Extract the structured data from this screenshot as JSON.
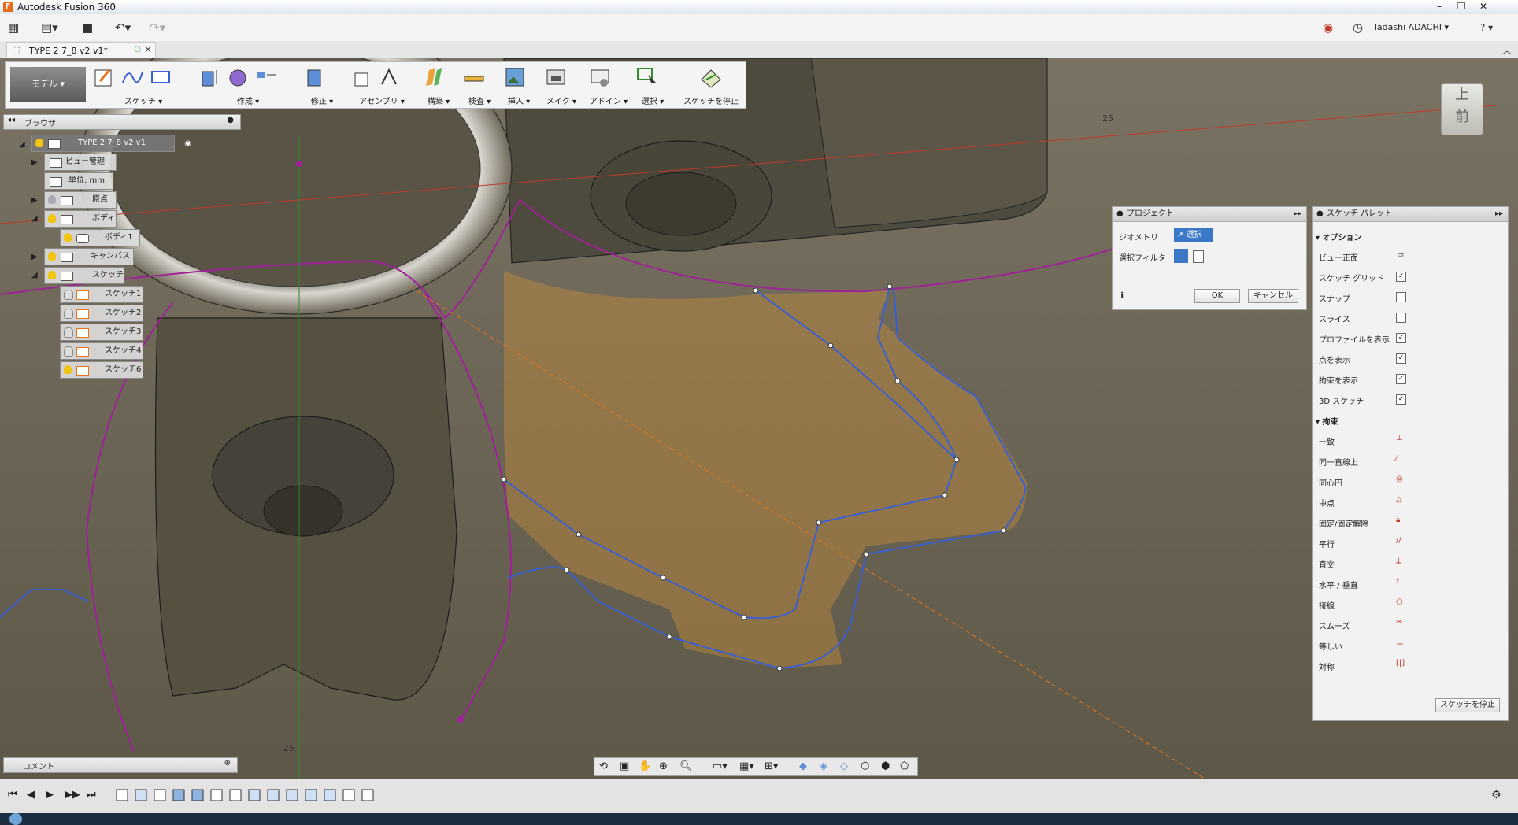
{
  "app": {
    "title": "Autodesk Fusion 360"
  },
  "window_controls": [
    "–",
    "❐",
    "✕"
  ],
  "quickbar": {
    "user": "Tadashi ADACHI ▾",
    "help": "? ▾"
  },
  "tab": {
    "label": "TYPE 2 7_8 v2 v1*"
  },
  "toolbar": {
    "mode": "モデル ▾",
    "groups": [
      {
        "label": "スケッチ ▾"
      },
      {
        "label": "作成 ▾"
      },
      {
        "label": "修正 ▾"
      },
      {
        "label": "アセンブリ ▾"
      },
      {
        "label": "構築 ▾"
      },
      {
        "label": "検査 ▾"
      },
      {
        "label": "挿入 ▾"
      },
      {
        "label": "メイク ▾"
      },
      {
        "label": "アドイン ▾"
      },
      {
        "label": "選択 ▾"
      },
      {
        "label": "スケッチを停止"
      }
    ]
  },
  "browser": {
    "header": "ブラウザ",
    "root": "TYPE 2 7_8 v2 v1",
    "nodes": [
      {
        "label": "ビュー管理"
      },
      {
        "label": "単位: mm"
      },
      {
        "label": "原点"
      },
      {
        "label": "ボディ"
      },
      {
        "label": "ボディ1"
      },
      {
        "label": "キャンバス"
      },
      {
        "label": "スケッチ"
      },
      {
        "label": "スケッチ1"
      },
      {
        "label": "スケッチ2"
      },
      {
        "label": "スケッチ3"
      },
      {
        "label": "スケッチ4"
      },
      {
        "label": "スケッチ6"
      }
    ]
  },
  "project_dialog": {
    "title": "プロジェクト",
    "geometry_label": "ジオメトリ",
    "geometry_value": "選択",
    "filter_label": "選択フィルタ",
    "ok": "OK",
    "cancel": "キャンセル"
  },
  "sketch_palette": {
    "title": "スケッチ パレット",
    "options_header": "オプション",
    "options": [
      {
        "label": "ビュー正面",
        "checked": null
      },
      {
        "label": "スケッチ グリッド",
        "checked": true
      },
      {
        "label": "スナップ",
        "checked": false
      },
      {
        "label": "スライス",
        "checked": false
      },
      {
        "label": "プロファイルを表示",
        "checked": true
      },
      {
        "label": "点を表示",
        "checked": true
      },
      {
        "label": "拘束を表示",
        "checked": true
      },
      {
        "label": "3D スケッチ",
        "checked": true
      }
    ],
    "constraints_header": "拘束",
    "constraints": [
      {
        "label": "一致",
        "icon": "coincident-icon"
      },
      {
        "label": "同一直線上",
        "icon": "collinear-icon"
      },
      {
        "label": "同心円",
        "icon": "concentric-icon"
      },
      {
        "label": "中点",
        "icon": "midpoint-icon"
      },
      {
        "label": "固定/固定解除",
        "icon": "lock-icon"
      },
      {
        "label": "平行",
        "icon": "parallel-icon"
      },
      {
        "label": "直交",
        "icon": "perpendicular-icon"
      },
      {
        "label": "水平 / 垂直",
        "icon": "horizontal-vertical-icon"
      },
      {
        "label": "接線",
        "icon": "tangent-icon"
      },
      {
        "label": "スムーズ",
        "icon": "smooth-icon"
      },
      {
        "label": "等しい",
        "icon": "equal-icon"
      },
      {
        "label": "対称",
        "icon": "symmetric-icon"
      }
    ],
    "stop_button": "スケッチを停止"
  },
  "comment": {
    "label": "コメント"
  },
  "viewcube": {
    "top": "上",
    "front": "前"
  },
  "viewport": {
    "dim_label_1": "25",
    "dim_label_2": "25"
  },
  "colors": {
    "accent": "#e8731a",
    "sketch_curve": "#3a5fd0",
    "profile": "#c48b3a",
    "construction": "#a0209a"
  }
}
